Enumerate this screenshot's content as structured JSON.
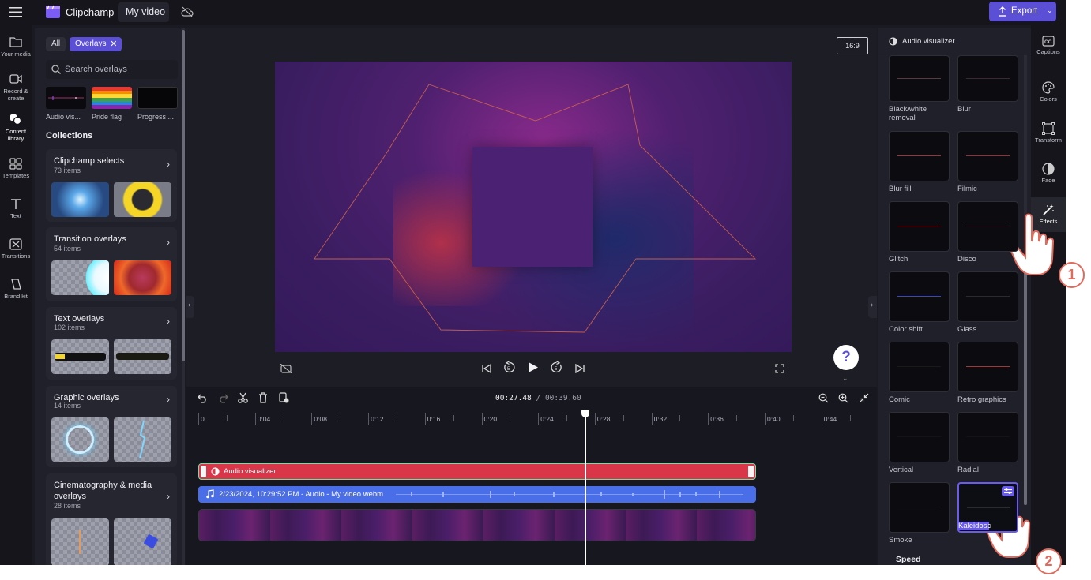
{
  "topbar": {
    "app_name": "Clipchamp",
    "project_name": "My video",
    "export_label": "Export"
  },
  "left_rail": {
    "items": [
      {
        "label": "Your media"
      },
      {
        "label": "Record & create"
      },
      {
        "label": "Content library"
      },
      {
        "label": "Templates"
      },
      {
        "label": "Text"
      },
      {
        "label": "Transitions"
      },
      {
        "label": "Brand kit"
      }
    ]
  },
  "library": {
    "filter_all": "All",
    "filter_active": "Overlays",
    "search_placeholder": "Search overlays",
    "thumbs": [
      {
        "label": "Audio vis..."
      },
      {
        "label": "Pride flag"
      },
      {
        "label": "Progress ..."
      }
    ],
    "collections_heading": "Collections",
    "collections": [
      {
        "title": "Clipchamp selects",
        "count": "73 items"
      },
      {
        "title": "Transition overlays",
        "count": "54 items"
      },
      {
        "title": "Text overlays",
        "count": "102 items"
      },
      {
        "title": "Graphic overlays",
        "count": "14 items"
      },
      {
        "title": "Cinematography & media overlays",
        "count": "28 items"
      }
    ]
  },
  "preview": {
    "aspect_ratio": "16:9",
    "help": "?"
  },
  "timeline": {
    "current_time": "00:27.48",
    "separator": " / ",
    "total_time": "00:39.60",
    "ruler": [
      "0",
      "0:04",
      "0:08",
      "0:12",
      "0:16",
      "0:20",
      "0:24",
      "0:28",
      "0:32",
      "0:36",
      "0:40",
      "0:44"
    ],
    "tracks": {
      "overlay_label": "Audio visualizer",
      "audio_label": "2/23/2024, 10:29:52 PM - Audio - My video.webm"
    }
  },
  "effects_panel": {
    "header": "Audio visualizer",
    "effects": [
      {
        "label": "Black/white removal"
      },
      {
        "label": "Blur"
      },
      {
        "label": "Blur fill"
      },
      {
        "label": "Filmic"
      },
      {
        "label": "Glitch"
      },
      {
        "label": "Disco"
      },
      {
        "label": "Color shift"
      },
      {
        "label": "Glass"
      },
      {
        "label": "Comic"
      },
      {
        "label": "Retro graphics"
      },
      {
        "label": "Vertical"
      },
      {
        "label": "Radial"
      },
      {
        "label": "Smoke"
      },
      {
        "label": "Kaleidosc"
      }
    ],
    "speed_label": "Speed"
  },
  "property_rail": {
    "items": [
      {
        "label": "Captions"
      },
      {
        "label": "Colors"
      },
      {
        "label": "Transform"
      },
      {
        "label": "Fade"
      },
      {
        "label": "Effects"
      }
    ]
  },
  "annotations": {
    "step_1": "1",
    "step_2": "2"
  },
  "colors": {
    "accent": "#5b4fd6",
    "overlay_track": "#d9364a",
    "audio_track": "#4a6ee8",
    "annotation": "#e06a5c"
  }
}
